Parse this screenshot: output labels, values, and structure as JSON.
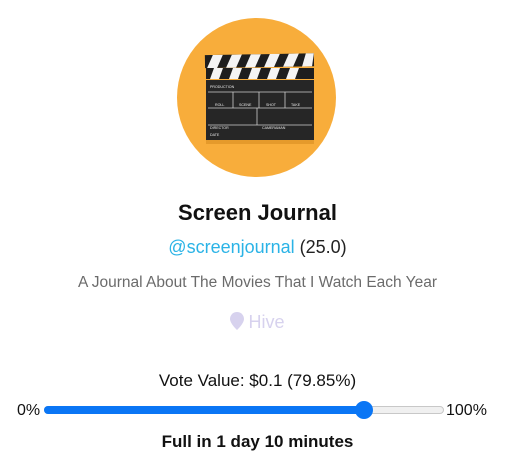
{
  "profile": {
    "name": "Screen Journal",
    "handle": "@screenjournal",
    "reputation": "(25.0)",
    "about": "A Journal About The Movies That I Watch Each Year",
    "location": "Hive",
    "avatar_icon": "clapperboard-icon"
  },
  "clapperboard": {
    "row1": "PRODUCTION",
    "roll": "ROLL",
    "scene": "SCENE",
    "shot": "SHOT",
    "take": "TAKE",
    "director": "DIRECTOR",
    "cameraman": "CAMERAMAN",
    "date": "DATE"
  },
  "vote": {
    "label": "Vote Value: $0.1 (79.85%)",
    "min_label": "0%",
    "max_label": "100%",
    "slider_value_percent": 79.85,
    "full_in": "Full in 1 day 10 minutes"
  },
  "colors": {
    "avatar_bg": "#f8ad3b",
    "handle": "#2ab3e6",
    "slider": "#0a76f5",
    "location": "#d7d2ee"
  }
}
